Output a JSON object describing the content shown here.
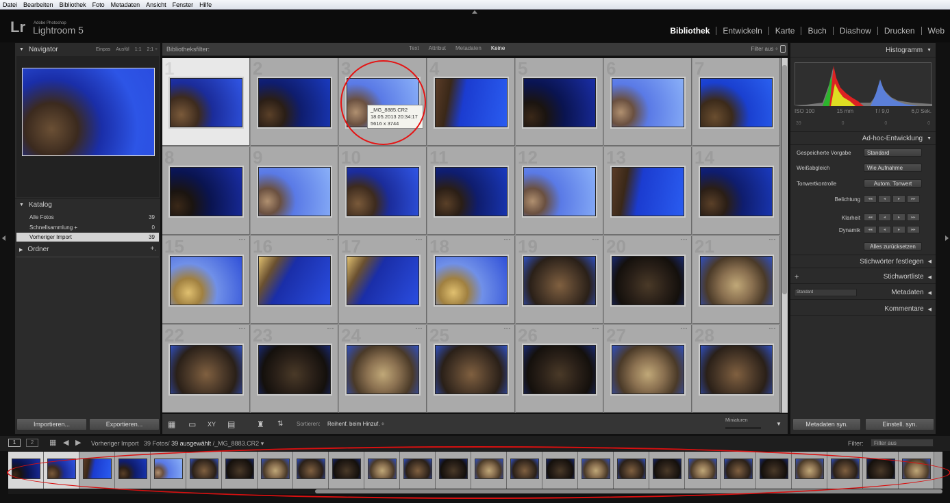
{
  "menu": [
    "Datei",
    "Bearbeiten",
    "Bibliothek",
    "Foto",
    "Metadaten",
    "Ansicht",
    "Fenster",
    "Hilfe"
  ],
  "identity": {
    "logo": "Lr",
    "small": "Adobe Photoshop",
    "name": "Lightroom 5"
  },
  "modules": [
    {
      "label": "Bibliothek",
      "active": true
    },
    {
      "label": "Entwickeln",
      "active": false
    },
    {
      "label": "Karte",
      "active": false
    },
    {
      "label": "Buch",
      "active": false
    },
    {
      "label": "Diashow",
      "active": false
    },
    {
      "label": "Drucken",
      "active": false
    },
    {
      "label": "Web",
      "active": false
    }
  ],
  "navigator": {
    "title": "Navigator",
    "options": [
      "Einpas",
      "Ausfül",
      "1:1",
      "2:1 ÷"
    ]
  },
  "catalog": {
    "title": "Katalog",
    "items": [
      {
        "label": "Alle Fotos",
        "count": "39",
        "selected": false
      },
      {
        "label": "Schnellsammlung +",
        "count": "0",
        "selected": false
      },
      {
        "label": "Vorheriger Import",
        "count": "39",
        "selected": true
      }
    ]
  },
  "folders": {
    "title": "Ordner",
    "add": "+."
  },
  "buttons": {
    "import": "Importieren...",
    "export": "Exportieren...",
    "meta_sync": "Metadaten syn.",
    "settings_sync": "Einstell. syn."
  },
  "filterbar": {
    "label": "Bibliotheksfilter:",
    "options": [
      "Text",
      "Attribut",
      "Metadaten",
      "Keine"
    ],
    "active": "Keine",
    "right": "Filter aus ÷"
  },
  "tooltip": {
    "filename": "_MG_8885.CR2",
    "date": "18.05.2013 20:34:17",
    "size": "5616 x 3744"
  },
  "grid": {
    "columns": 7,
    "selected": 1,
    "cells": [
      {
        "n": "1",
        "t": "a"
      },
      {
        "n": "2",
        "t": "b"
      },
      {
        "n": "3",
        "t": "c"
      },
      {
        "n": "4",
        "t": "d"
      },
      {
        "n": "5",
        "t": "e"
      },
      {
        "n": "6",
        "t": "c"
      },
      {
        "n": "7",
        "t": "f"
      },
      {
        "n": "8",
        "t": "e"
      },
      {
        "n": "9",
        "t": "c"
      },
      {
        "n": "10",
        "t": "a"
      },
      {
        "n": "11",
        "t": "b"
      },
      {
        "n": "12",
        "t": "c"
      },
      {
        "n": "13",
        "t": "d"
      },
      {
        "n": "14",
        "t": "b"
      },
      {
        "n": "15",
        "t": "g"
      },
      {
        "n": "16",
        "t": "h"
      },
      {
        "n": "17",
        "t": "h"
      },
      {
        "n": "18",
        "t": "g"
      },
      {
        "n": "19",
        "t": "i"
      },
      {
        "n": "20",
        "t": "j"
      },
      {
        "n": "21",
        "t": "k"
      },
      {
        "n": "22",
        "t": "i"
      },
      {
        "n": "23",
        "t": "j"
      },
      {
        "n": "24",
        "t": "k"
      },
      {
        "n": "25",
        "t": "i"
      },
      {
        "n": "26",
        "t": "j"
      },
      {
        "n": "27",
        "t": "k"
      },
      {
        "n": "28",
        "t": "i"
      }
    ]
  },
  "toolbar": {
    "sort_label": "Sortieren:",
    "sort_value": "Reihenf. beim Hinzuf. ÷",
    "thumbnails_label": "Miniaturen"
  },
  "histogram": {
    "title": "Histogramm",
    "iso": "ISO 100",
    "focal": "15 mm",
    "aperture": "f / 9,0",
    "shutter": "6,0 Sek.",
    "counts": [
      "39",
      "0",
      "0",
      "0"
    ]
  },
  "quick_develop": {
    "title": "Ad-hoc-Entwicklung",
    "preset_label": "Gespeicherte Vorgabe",
    "preset_value": "Standard",
    "wb_label": "Weißabgleich",
    "wb_value": "Wie Aufnahme",
    "tone_label": "Tonwertkontrolle",
    "tone_button": "Autom. Tonwert",
    "exposure": "Belichtung",
    "clarity": "Klarheit",
    "vibrance": "Dynamik",
    "step": [
      "◂◂",
      "◂",
      "▸",
      "▸▸"
    ],
    "reset": "Alles zurücksetzen"
  },
  "right_sections": {
    "keywording": "Stichwörter festlegen",
    "keyword_list": "Stichwortliste",
    "metadata": "Metadaten",
    "metadata_preset": "Standard",
    "comments": "Kommentare"
  },
  "filmstrip": {
    "source": "Vorheriger Import",
    "count": "39 Fotos/",
    "selected": "39 ausgewählt",
    "file": "/_MG_8883.CR2 ▾",
    "filter_label": "Filter:",
    "filter_value": "Filter aus",
    "thumbs": [
      "e",
      "a",
      "d",
      "b",
      "c",
      "i",
      "j",
      "k",
      "i",
      "j",
      "k",
      "i",
      "j",
      "k",
      "i",
      "j",
      "k",
      "i",
      "j",
      "k",
      "i",
      "j",
      "k",
      "i",
      "j",
      "k"
    ]
  },
  "colors": {
    "annotation": "#e41414",
    "selected_bg": "#e8e8e8",
    "panel": "#2b2b2b"
  }
}
